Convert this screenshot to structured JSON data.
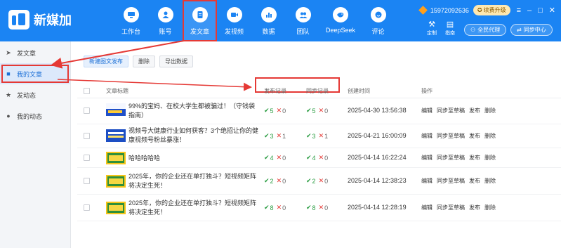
{
  "app": {
    "name": "新媒加"
  },
  "nav": {
    "items": [
      {
        "label": "工作台",
        "icon": "monitor-icon"
      },
      {
        "label": "账号",
        "icon": "user-icon"
      },
      {
        "label": "发文章",
        "icon": "document-icon"
      },
      {
        "label": "发视频",
        "icon": "video-icon"
      },
      {
        "label": "数据",
        "icon": "bar-chart-icon"
      },
      {
        "label": "团队",
        "icon": "team-icon"
      },
      {
        "label": "DeepSeek",
        "icon": "whale-icon"
      },
      {
        "label": "评论",
        "icon": "comment-icon"
      }
    ],
    "active": "发文章"
  },
  "account": {
    "phone": "15972092636",
    "vip_label": "续费升级"
  },
  "tools": [
    {
      "label": "定制"
    },
    {
      "label": "指南"
    }
  ],
  "pills": {
    "agent": "全民代理",
    "sync": "同步中心"
  },
  "sidebar": {
    "items": [
      {
        "label": "发文章",
        "icon": "send-icon"
      },
      {
        "label": "我的文章",
        "icon": "list-icon"
      },
      {
        "label": "发动态",
        "icon": "star-icon"
      },
      {
        "label": "我的动态",
        "icon": "gear-icon"
      }
    ],
    "active": "我的文章"
  },
  "toolbar": {
    "new_label": "新建图文发布",
    "delete_label": "删除",
    "export_label": "导出数据"
  },
  "table": {
    "headers": {
      "title": "文章标题",
      "publish": "发布记录",
      "sync": "同步记录",
      "created": "创建时间",
      "actions": "操作"
    },
    "actions": {
      "edit": "编辑",
      "sync_draft": "同步至草稿",
      "publish": "发布",
      "delete": "删除"
    },
    "rows": [
      {
        "title": "99%的宝妈、在校大学生都被骗过！（守钱袋指南）",
        "publish_ok": "5",
        "publish_fail": "0",
        "sync_ok": "5",
        "sync_fail": "0",
        "created": "2025-04-30 13:56:38"
      },
      {
        "title": "视频号大健康行业如何获客？3个绝招让你的健康视频号粉丝暴涨！",
        "publish_ok": "3",
        "publish_fail": "1",
        "sync_ok": "3",
        "sync_fail": "1",
        "created": "2025-04-21 16:00:09"
      },
      {
        "title": "哈哈哈哈哈",
        "publish_ok": "4",
        "publish_fail": "0",
        "sync_ok": "4",
        "sync_fail": "0",
        "created": "2025-04-14 16:22:24"
      },
      {
        "title": "2025年，你的企业还在单打独斗？短视频矩阵将决定生死！",
        "publish_ok": "2",
        "publish_fail": "0",
        "sync_ok": "2",
        "sync_fail": "0",
        "created": "2025-04-14 12:38:23"
      },
      {
        "title": "2025年，你的企业还在单打独斗？短视频矩阵将决定生死！",
        "publish_ok": "8",
        "publish_fail": "0",
        "sync_ok": "8",
        "sync_fail": "0",
        "created": "2025-04-14 12:28:19"
      }
    ]
  },
  "colors": {
    "brand": "#1b84f3",
    "highlight": "#e53935",
    "ok": "#2e9e45"
  }
}
